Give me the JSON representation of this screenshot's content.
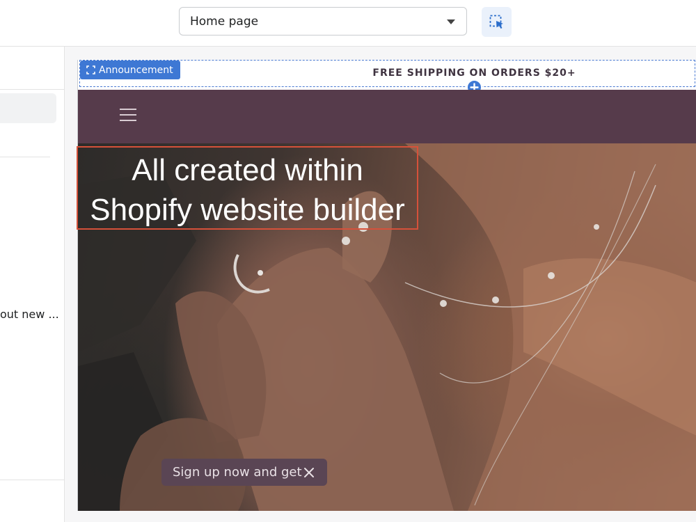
{
  "toolbar": {
    "page_selector": {
      "value": "Home page"
    },
    "inspector_icon": "select-inspect-icon"
  },
  "sidebar": {
    "truncated_item": "out new ..."
  },
  "preview": {
    "announcement": {
      "section_tag": "Announcement",
      "text": "FREE SHIPPING ON ORDERS $20+"
    },
    "header": {
      "menu_icon": "hamburger-menu-icon"
    },
    "hero": {
      "headline_line1": "All created within",
      "headline_line2": "Shopify website builder"
    },
    "signup_popup": {
      "text": "Sign up now and get"
    }
  },
  "colors": {
    "accent": "#3e78d4",
    "header_bg": "#563b4b",
    "highlight_border": "#d6513a",
    "popup_bg": "#5a4554"
  }
}
